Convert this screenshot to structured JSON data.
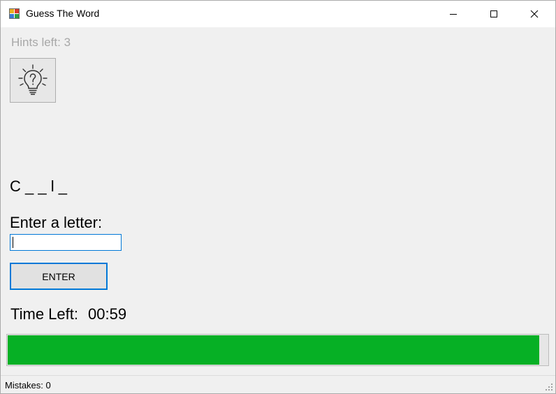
{
  "window": {
    "title": "Guess The Word",
    "app_icon": "winforms-app-icon",
    "controls": [
      "minimize-icon",
      "maximize-icon",
      "close-icon"
    ]
  },
  "hints": {
    "label": "Hints left: 3",
    "button_icon": "lightbulb-question-icon"
  },
  "game": {
    "word_pattern": "C _ _ l _",
    "prompt": "Enter a letter:",
    "input_value": "",
    "enter_button": "ENTER"
  },
  "timer": {
    "label": "Time Left:",
    "value": "00:59",
    "progress_fraction": 0.985,
    "progress_color": "#06b025"
  },
  "status": {
    "mistakes": "Mistakes: 0"
  }
}
